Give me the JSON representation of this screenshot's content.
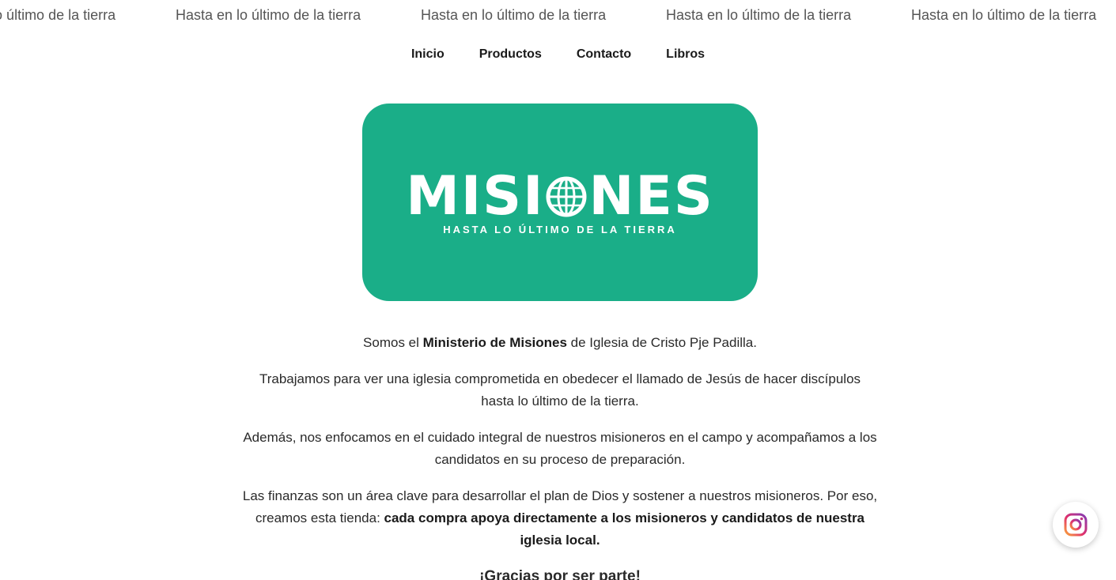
{
  "ticker": {
    "items": [
      "Hasta en lo último de la tierra",
      "Hasta en lo último de la tierra",
      "Hasta en lo último de la tierra",
      "Hasta en lo último de la tierra",
      "Hasta en lo último de la tierra"
    ]
  },
  "nav": {
    "items": [
      {
        "label": "Inicio"
      },
      {
        "label": "Productos"
      },
      {
        "label": "Contacto"
      },
      {
        "label": "Libros"
      }
    ]
  },
  "hero": {
    "logo_left": "MISI",
    "logo_right": "NES",
    "tagline": "HASTA LO ÚLTIMO DE LA TIERRA",
    "background_color": "#1aae88",
    "globe_icon": "globe-icon"
  },
  "content": {
    "p1_a": "Somos el ",
    "p1_bold": "Ministerio de Misiones",
    "p1_b": " de Iglesia de Cristo Pje Padilla.",
    "p2": "Trabajamos para ver una iglesia comprometida en obedecer el llamado de Jesús de hacer discípulos hasta lo último de la tierra.",
    "p3": "Además, nos enfocamos en el cuidado integral de nuestros misioneros en el campo y acompañamos a los candidatos en su proceso de preparación.",
    "p4_a": "Las finanzas son un área clave para desarrollar el plan de Dios y sostener a nuestros misioneros. Por eso, creamos esta tienda: ",
    "p4_bold": "cada compra apoya directamente a los misioneros y candidatos de nuestra iglesia local.",
    "thanks": "¡Gracias por ser parte!"
  },
  "floating": {
    "icon": "instagram-icon"
  }
}
